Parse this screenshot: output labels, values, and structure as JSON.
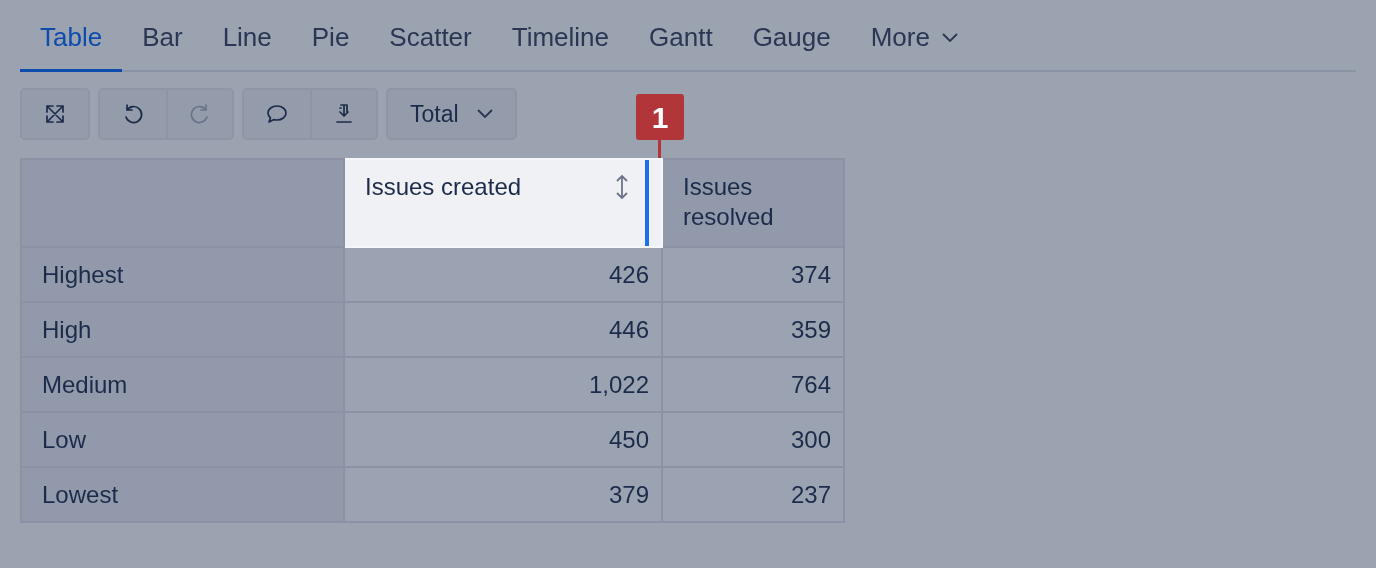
{
  "tabs": [
    {
      "label": "Table",
      "selected": true
    },
    {
      "label": "Bar",
      "selected": false
    },
    {
      "label": "Line",
      "selected": false
    },
    {
      "label": "Pie",
      "selected": false
    },
    {
      "label": "Scatter",
      "selected": false
    },
    {
      "label": "Timeline",
      "selected": false
    },
    {
      "label": "Gantt",
      "selected": false
    },
    {
      "label": "Gauge",
      "selected": false
    },
    {
      "label": "More",
      "selected": false,
      "kind": "dropdown"
    }
  ],
  "toolbar": [
    [
      {
        "kind": "fullscreen",
        "disabled": false
      }
    ],
    [
      {
        "kind": "undo",
        "disabled": false
      },
      {
        "kind": "redo",
        "disabled": true
      }
    ],
    [
      {
        "kind": "comment",
        "disabled": false
      },
      {
        "kind": "download",
        "disabled": false
      }
    ]
  ],
  "total_dropdown": {
    "label": "Total"
  },
  "table": {
    "columns": [
      {
        "label": "Issues created",
        "highlighted": true,
        "sortable": true
      },
      {
        "label": "Issues resolved",
        "highlighted": false,
        "sortable": false
      }
    ],
    "rows": [
      {
        "label": "Highest",
        "values": [
          "426",
          "374"
        ]
      },
      {
        "label": "High",
        "values": [
          "446",
          "359"
        ]
      },
      {
        "label": "Medium",
        "values": [
          "1,022",
          "764"
        ]
      },
      {
        "label": "Low",
        "values": [
          "450",
          "300"
        ]
      },
      {
        "label": "Lowest",
        "values": [
          "379",
          "237"
        ]
      }
    ]
  },
  "callout": {
    "label": "1"
  }
}
